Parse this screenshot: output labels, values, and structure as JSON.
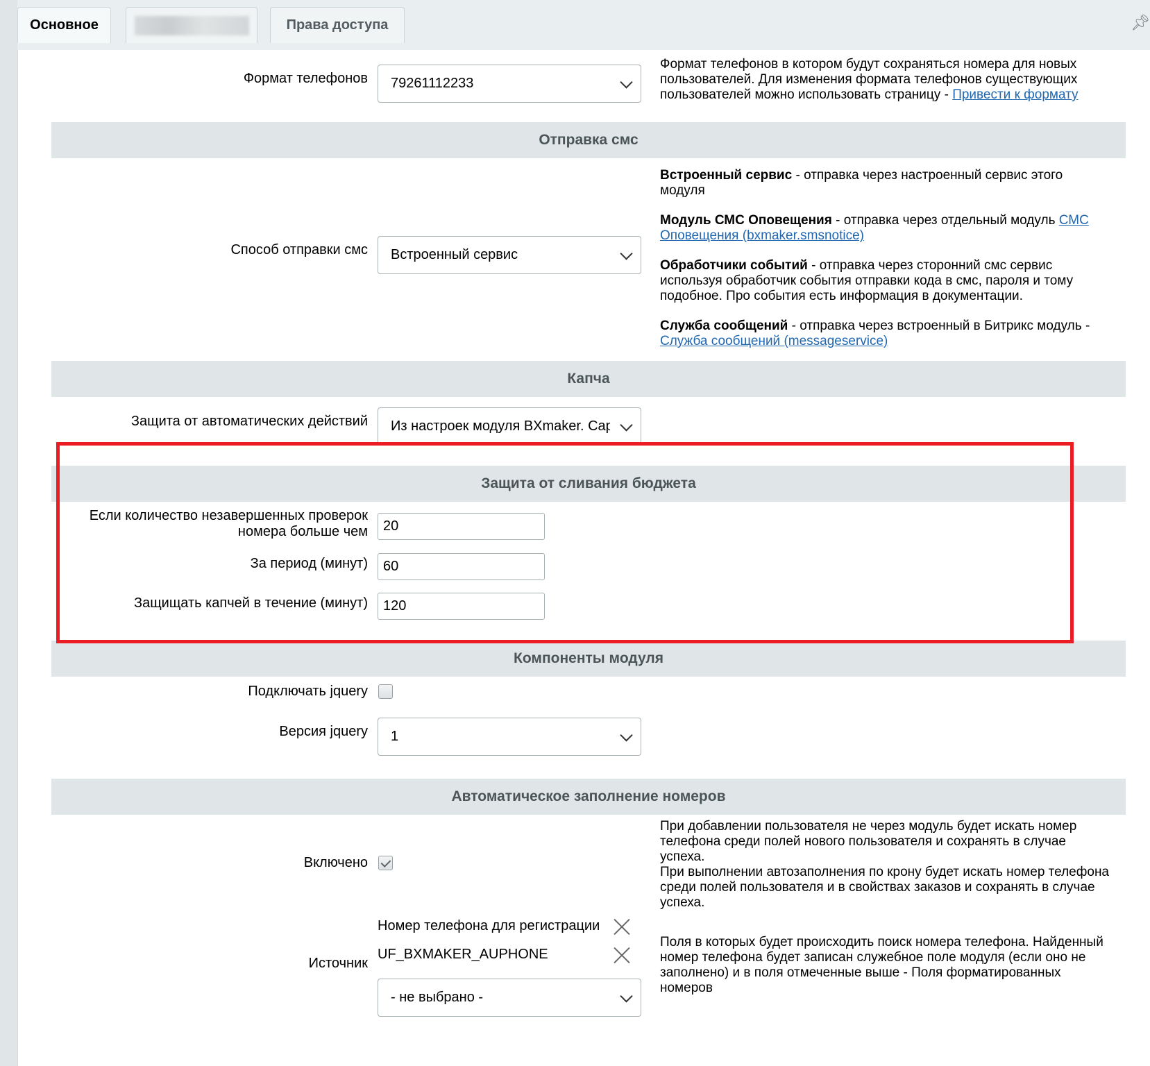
{
  "tabs": [
    "Основное",
    "",
    "Права доступа"
  ],
  "phone_format": {
    "label": "Формат телефонов",
    "value": "79261112233",
    "help_text": "Формат телефонов в котором будут сохраняться номера для новых пользователей. Для изменения формата телефонов существующих пользователей можно использовать страницу - ",
    "help_link": "Привести к формату"
  },
  "sms_section": {
    "title": "Отправка смс",
    "method_label": "Способ отправки смс",
    "method_value": "Встроенный сервис",
    "help": {
      "builtin_title": "Встроенный сервис",
      "builtin_text": " - отправка через настроенный сервис этого модуля",
      "module_title": "Модуль СМС Оповещения",
      "module_text": " - отправка через отдельный модуль ",
      "module_link": "СМС Оповещения (bxmaker.smsnotice)",
      "handlers_title": "Обработчики событий",
      "handlers_text": " - отправка через сторонний смс сервис используя обработчик события отправки кода в смс, пароля и тому подобное. Про события есть информация в документации.",
      "msgservice_title": "Служба сообщений",
      "msgservice_text": " - отправка через встроенный в Битрикс модуль - ",
      "msgservice_link": "Служба сообщений (messageservice)"
    }
  },
  "captcha_section": {
    "title": "Капча",
    "protection_label": "Защита от автоматических действий",
    "protection_value": "Из настроек модуля BXmaker. Captcha"
  },
  "budget_section": {
    "title": "Защита от сливания бюджета",
    "checks_label_line1": "Если количество незавершенных проверок",
    "checks_label_line2": "номера больше чем",
    "checks_value": "20",
    "period_label": "За период (минут)",
    "period_value": "60",
    "captcha_time_label": "Защищать капчей в течение (минут)",
    "captcha_time_value": "120"
  },
  "components_section": {
    "title": "Компоненты модуля",
    "jquery_label": "Подключать jquery",
    "jquery_checked": false,
    "jquery_version_label": "Версия jquery",
    "jquery_version_value": "1"
  },
  "autofill_section": {
    "title": "Автоматическое заполнение номеров",
    "enabled_label": "Включено",
    "enabled_checked": true,
    "enabled_help_1": "При добавлении пользователя не через модуль будет искать номер телефона среди полей нового пользователя и сохранять в случае успеха.",
    "enabled_help_2": "При выполнении автозаполнения по крону будет искать номер телефона среди полей пользователя и в свойствах заказов и сохранять в случае успеха.",
    "source_label": "Источник",
    "source_items": [
      "Номер телефона для регистрации",
      "UF_BXMAKER_AUPHONE"
    ],
    "source_select_value": "- не выбрано -",
    "source_help": "Поля в которых будет происходить поиск номера телефона. Найденный номер телефона будет записан служебное поле модуля (если оно не заполнено) и в поля отмеченные выше - Поля форматированных номеров"
  }
}
